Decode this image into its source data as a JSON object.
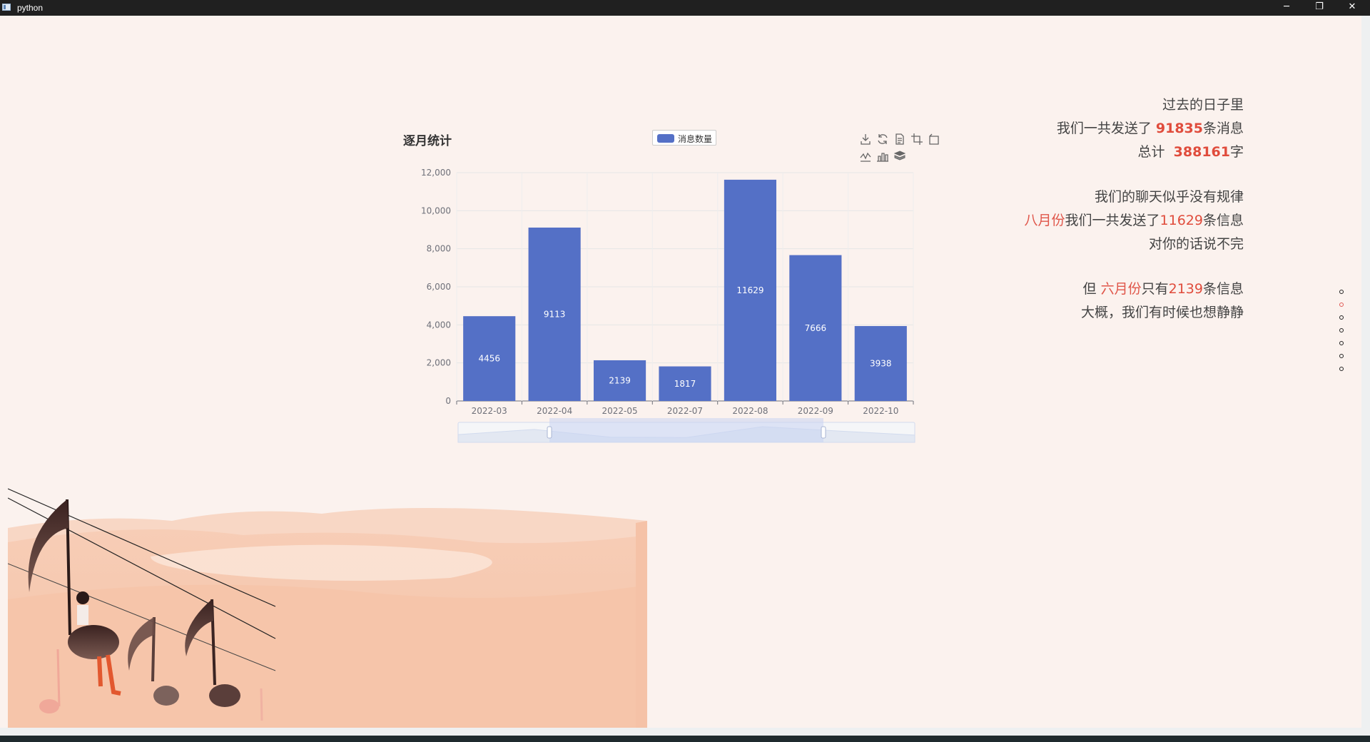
{
  "window": {
    "title": "python",
    "controls": [
      "minimize",
      "restore",
      "close"
    ]
  },
  "chart_data": {
    "type": "bar",
    "title": "逐月统计",
    "legend": [
      "消息数量"
    ],
    "categories": [
      "2022-03",
      "2022-04",
      "2022-05",
      "2022-07",
      "2022-08",
      "2022-09",
      "2022-10"
    ],
    "series": [
      {
        "name": "消息数量",
        "values": [
          4456,
          9113,
          2139,
          1817,
          11629,
          7666,
          3938
        ],
        "color": "#5470c6"
      }
    ],
    "yticks": [
      "0",
      "2,000",
      "4,000",
      "6,000",
      "8,000",
      "10,000",
      "12,000"
    ],
    "ylim": [
      0,
      12000
    ],
    "grid": true,
    "legend_position": "top-center",
    "data_zoom": true,
    "toolbox": [
      "download-icon",
      "refresh-icon",
      "data-view-icon",
      "zoom-icon",
      "zoom-reset-icon",
      "line-chart-icon",
      "bar-chart-icon",
      "stack-icon"
    ]
  },
  "story": {
    "l1": "过去的日子里",
    "l2_pre": "我们一共发送了",
    "l2_num": "91835",
    "l2_post": "条消息",
    "l3_pre": "总计",
    "l3_num": "388161",
    "l3_post": "字",
    "l4": "我们的聊天似乎没有规律",
    "l5_red": "八月份",
    "l5_mid": "我们一共发送了",
    "l5_num": "11629",
    "l5_post": "条信息",
    "l6": "对你的话说不完",
    "l7_pre": "但",
    "l7_red": "六月份",
    "l7_mid": "只有",
    "l7_num": "2139",
    "l7_post": "条信息",
    "l8": "大概，我们有时候也想静静"
  },
  "pagination": {
    "count": 7,
    "active_index": 1,
    "active_color": "#e05a55"
  },
  "colors": {
    "background": "#fbf2ee",
    "accent": "#e04c3c",
    "bar": "#5470c6"
  }
}
